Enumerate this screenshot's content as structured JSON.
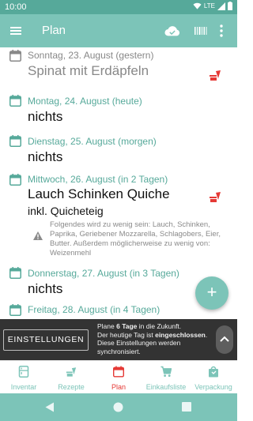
{
  "status": {
    "time": "10:00",
    "network": "LTE"
  },
  "app_bar": {
    "title": "Plan"
  },
  "days": [
    {
      "date": "Sonntag, 23. August (gestern)",
      "meal": "Spinat mit Erdäpfeln"
    },
    {
      "date": "Montag, 24. August (heute)",
      "meal": "nichts"
    },
    {
      "date": "Dienstag, 25. August (morgen)",
      "meal": "nichts"
    },
    {
      "date": "Mittwoch, 26. August (in 2 Tagen)",
      "meal": "Lauch Schinken Quiche",
      "sub": "inkl. Quicheteig",
      "warning": "Folgendes wird zu wenig sein: Lauch, Schinken, Paprika, Geriebener Mozzarella, Schlagobers, Eier, Butter. Außerdem möglicherweise zu wenig von: Weizenmehl"
    },
    {
      "date": "Donnerstag, 27. August (in 3 Tagen)",
      "meal": "nichts"
    },
    {
      "date": "Freitag, 28. August (in 4 Tagen)"
    }
  ],
  "fab": {
    "label": "+"
  },
  "snackbar": {
    "button": "EINSTELLUNGEN",
    "t1": "Plane ",
    "t2": "6 Tage",
    "t3": " in die Zukunft.",
    "t4": "Der heutige Tag ist ",
    "t5": "eingeschlossen",
    "t6": ".",
    "t7": "Diese Einstellungen werden synchronisiert."
  },
  "nav": [
    "Inventar",
    "Rezepte",
    "Plan",
    "Einkaufsliste",
    "Verpackung"
  ],
  "colors": {
    "primary": "#7cc4b8",
    "primary_dark": "#56a99a",
    "accent": "#e53935",
    "date_text": "#56a99a"
  }
}
